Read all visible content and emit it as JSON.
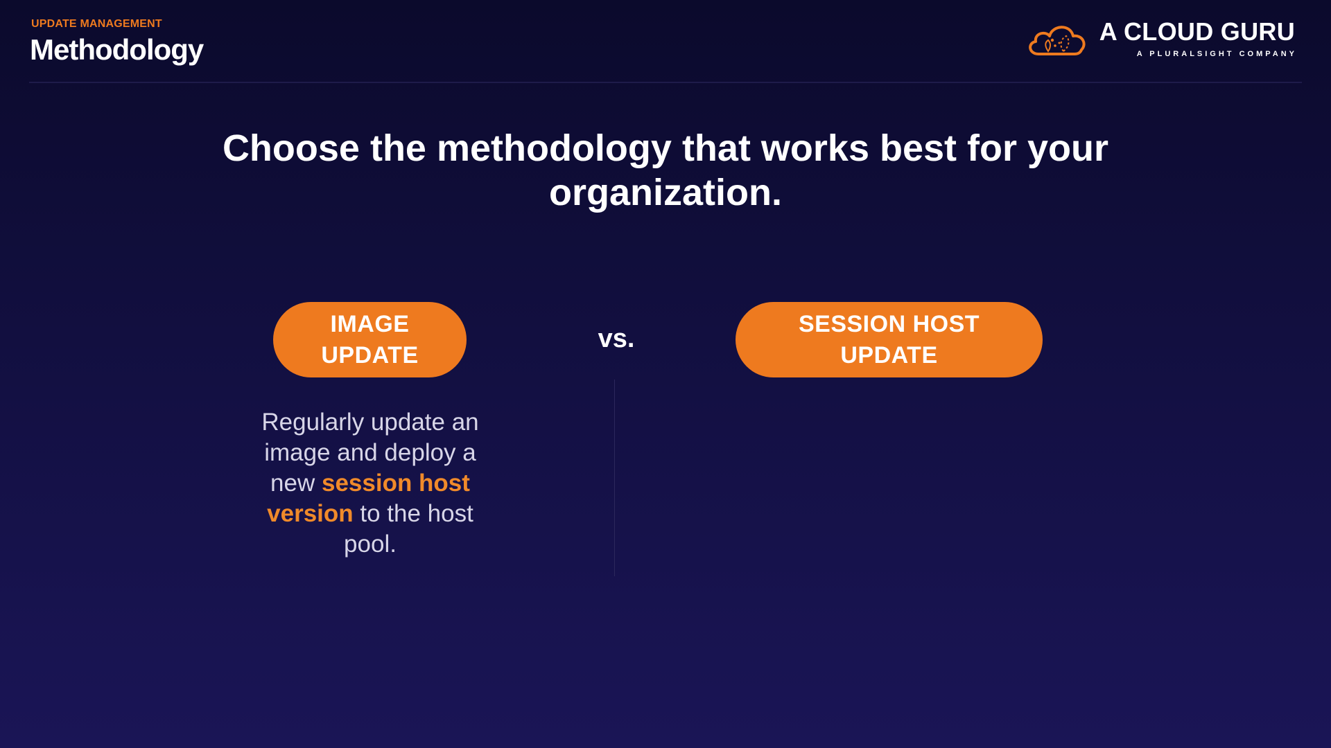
{
  "header": {
    "section_label": "UPDATE MANAGEMENT",
    "title": "Methodology"
  },
  "logo": {
    "name": "A CLOUD GURU",
    "subtitle": "A PLURALSIGHT COMPANY",
    "icon": "cloud-icon",
    "color": "#ee7a1f"
  },
  "main": {
    "headline_line1": "Choose the methodology that works best for your",
    "headline_line2": "organization.",
    "left_option": {
      "line1": "IMAGE",
      "line2": "UPDATE"
    },
    "vs_label": "vs.",
    "right_option": {
      "line1": "SESSION HOST",
      "line2": "UPDATE"
    },
    "left_description": {
      "part1": "Regularly update an image and deploy a new ",
      "highlight": "session host version",
      "part2": " to the host pool."
    }
  },
  "colors": {
    "accent": "#ee7a1f",
    "background_top": "#0b0a2c",
    "background_bottom": "#1a1556"
  }
}
